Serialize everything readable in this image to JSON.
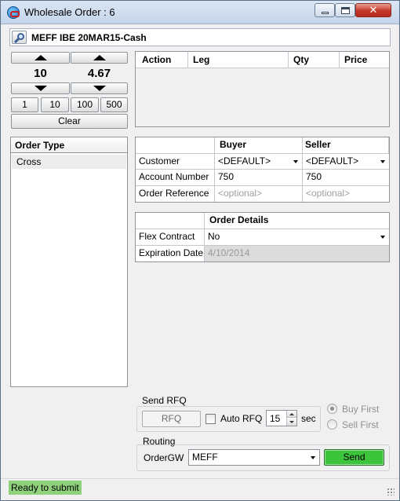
{
  "window": {
    "title": "Wholesale Order : 6"
  },
  "instrument": {
    "name": "MEFF IBE 20MAR15-Cash"
  },
  "steppers": {
    "quantity": "10",
    "price": "4.67",
    "quick_quantities": [
      "1",
      "10",
      "100",
      "500"
    ],
    "clear_label": "Clear"
  },
  "order_type": {
    "header": "Order Type",
    "items": [
      "Cross"
    ]
  },
  "legs_table": {
    "columns": [
      "Action",
      "Leg",
      "Qty",
      "Price"
    ],
    "rows": []
  },
  "parties": {
    "columns": [
      "",
      "Buyer",
      "Seller"
    ],
    "rows": [
      {
        "label": "Customer",
        "buyer": "<DEFAULT>",
        "seller": "<DEFAULT>"
      },
      {
        "label": "Account Number",
        "buyer": "750",
        "seller": "750"
      },
      {
        "label": "Order Reference",
        "buyer": "<optional>",
        "seller": "<optional>"
      }
    ]
  },
  "order_details": {
    "header": "Order Details",
    "rows": [
      {
        "label": "Flex Contract",
        "value": "No"
      },
      {
        "label": "Expiration Date",
        "value": "4/10/2014"
      }
    ]
  },
  "send_rfq": {
    "group_label": "Send RFQ",
    "rfq_button": "RFQ",
    "auto_rfq_label": "Auto RFQ",
    "auto_rfq_checked": false,
    "seconds_value": "15",
    "seconds_unit": "sec",
    "side_options": [
      "Buy First",
      "Sell First"
    ],
    "selected_side": "Buy First"
  },
  "routing": {
    "group_label": "Routing",
    "gateway_label": "OrderGW",
    "gateway_value": "MEFF",
    "send_label": "Send",
    "send_color": "#3dc43d"
  },
  "status": {
    "text": "Ready to submit",
    "color": "#8fd27b"
  }
}
